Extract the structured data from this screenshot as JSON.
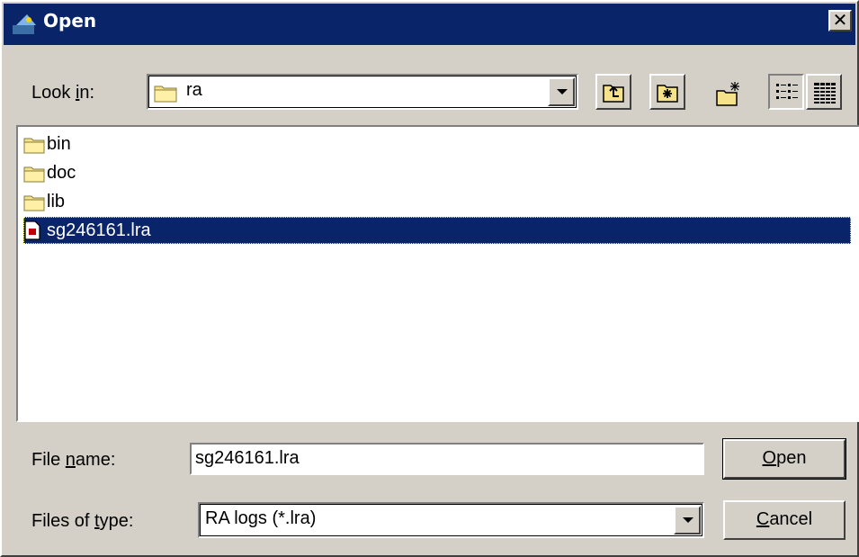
{
  "window": {
    "title": "Open",
    "close_glyph": "✕",
    "title_bar_color": "#0a246a"
  },
  "toolbar": {
    "look_in_prefix": "Look ",
    "look_in_mnemonic": "i",
    "look_in_suffix": "n:",
    "look_in_value": "ra",
    "icons": [
      "up-one-level-icon",
      "home-folder-icon",
      "new-folder-icon",
      "list-view-icon",
      "details-view-icon"
    ]
  },
  "files": [
    {
      "name": "bin",
      "type": "folder"
    },
    {
      "name": "doc",
      "type": "folder"
    },
    {
      "name": "lib",
      "type": "folder"
    },
    {
      "name": "sg246161.lra",
      "type": "file",
      "selected": true
    }
  ],
  "footer": {
    "file_name_prefix": "File ",
    "file_name_mnemonic": "n",
    "file_name_suffix": "ame:",
    "file_name_value": "sg246161.lra",
    "file_type_prefix": "Files of ",
    "file_type_mnemonic": "t",
    "file_type_suffix": "ype:",
    "file_type_value": "RA logs (*.lra)",
    "open_mnemonic": "O",
    "open_rest": "pen",
    "cancel_mnemonic": "C",
    "cancel_rest": "ancel"
  }
}
